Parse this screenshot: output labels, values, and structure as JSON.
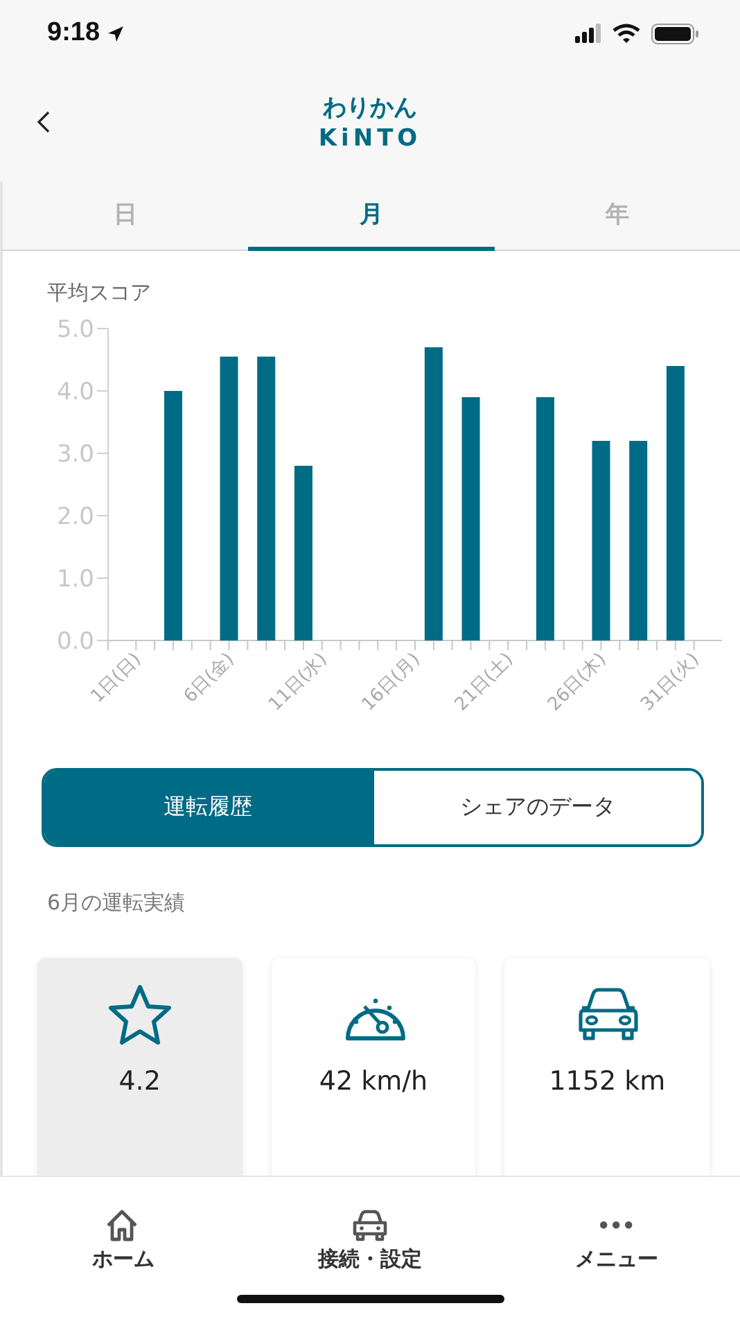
{
  "status_bar": {
    "time": "9:18"
  },
  "header": {
    "logo_top": "わりかん",
    "logo_bottom": "KiNTO"
  },
  "tabs": [
    {
      "label": "日",
      "selected": false
    },
    {
      "label": "月",
      "selected": true
    },
    {
      "label": "年",
      "selected": false
    }
  ],
  "chart_section": {
    "title": "平均スコア",
    "chart_data": {
      "type": "bar",
      "x": [
        3,
        6,
        8,
        10,
        17,
        19,
        23,
        26,
        28,
        30
      ],
      "values": [
        4.0,
        4.55,
        4.55,
        2.8,
        4.7,
        3.9,
        3.9,
        3.2,
        3.2,
        4.4
      ],
      "xlim": [
        -0.5,
        32.5
      ],
      "ylim": [
        0,
        5
      ],
      "yticks": [
        {
          "value": 0,
          "label": "0.0"
        },
        {
          "value": 1,
          "label": "1.0"
        },
        {
          "value": 2,
          "label": "2.0"
        },
        {
          "value": 3,
          "label": "3.0"
        },
        {
          "value": 4,
          "label": "4.0"
        },
        {
          "value": 5,
          "label": "5.0"
        }
      ],
      "xticks": [
        {
          "value": 1,
          "label": "1日(日)"
        },
        {
          "value": 6,
          "label": "6日(金)"
        },
        {
          "value": 11,
          "label": "11日(水)"
        },
        {
          "value": 16,
          "label": "16日(月)"
        },
        {
          "value": 21,
          "label": "21日(土)"
        },
        {
          "value": 26,
          "label": "26日(木)"
        },
        {
          "value": 31,
          "label": "31日(火)"
        }
      ]
    }
  },
  "segments": [
    {
      "label": "運転履歴",
      "selected": true
    },
    {
      "label": "シェアのデータ",
      "selected": false
    }
  ],
  "summary": {
    "title": "6月の運転実績",
    "cards": [
      {
        "kind": "star",
        "value": "4.2",
        "selected": true
      },
      {
        "kind": "speed",
        "value": "42 km/h",
        "selected": false
      },
      {
        "kind": "car",
        "value": "1152 km",
        "selected": false
      }
    ]
  },
  "bottom_nav": [
    {
      "kind": "home",
      "label": "ホーム"
    },
    {
      "kind": "car",
      "label": "接続・設定"
    },
    {
      "kind": "more",
      "label": "メニュー"
    }
  ]
}
